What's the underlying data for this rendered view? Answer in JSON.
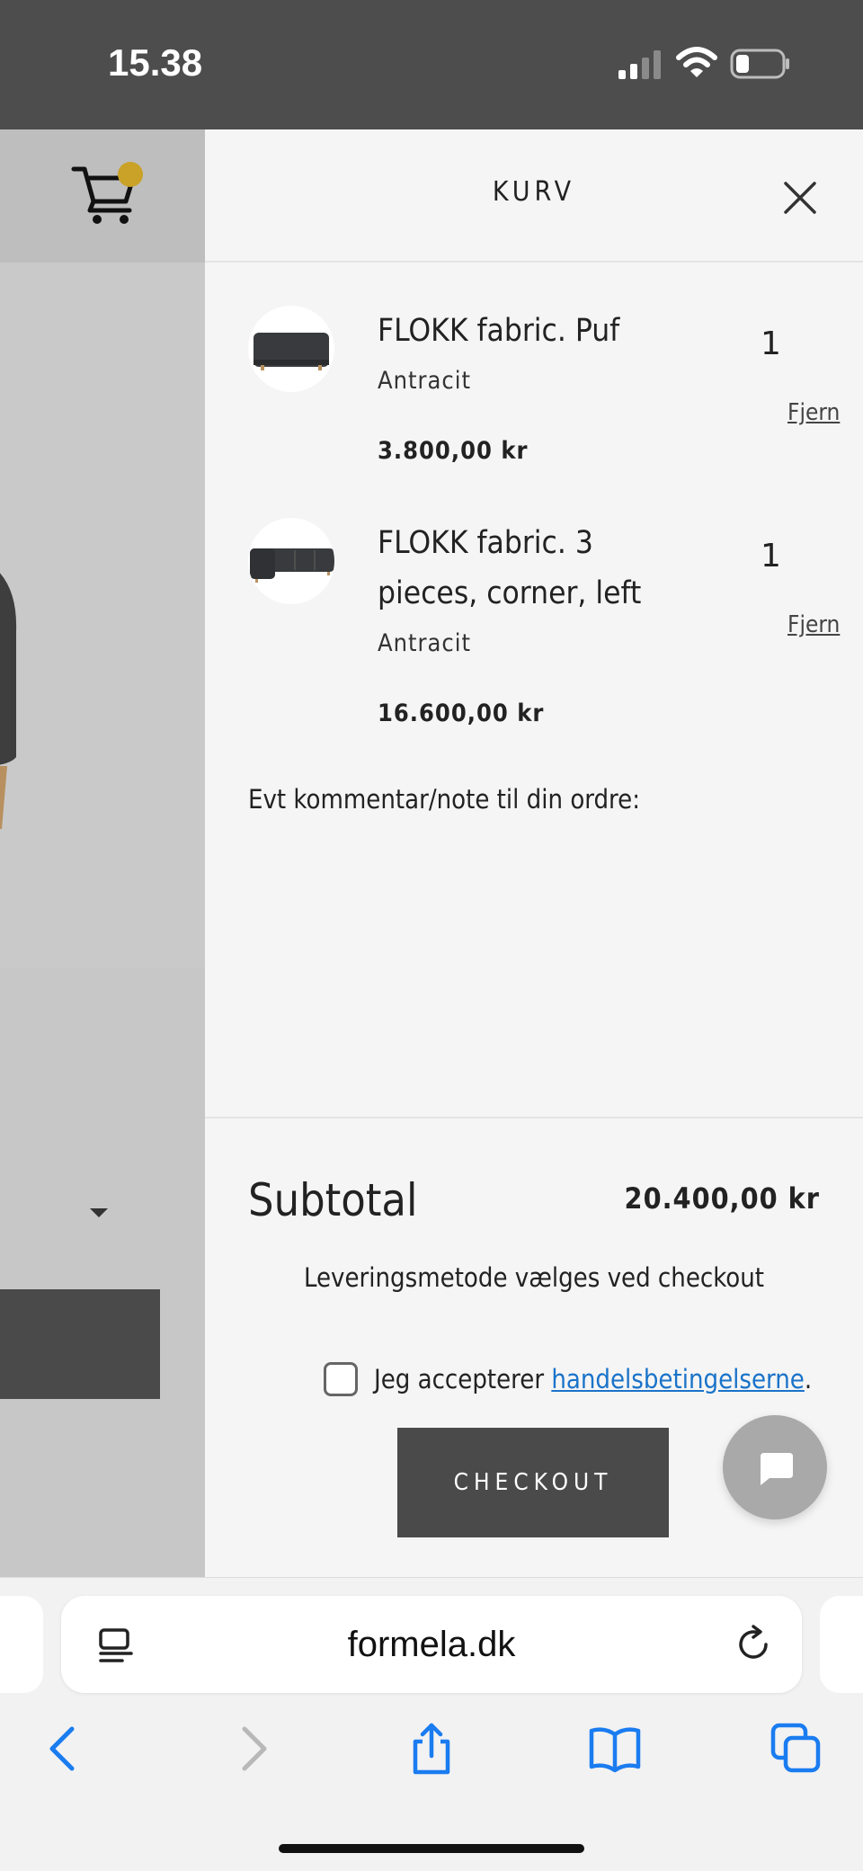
{
  "status_bar": {
    "time": "15.38"
  },
  "drawer": {
    "title": "KURV",
    "items": [
      {
        "name": "FLOKK fabric. Puf",
        "variant": "Antracit",
        "price": "3.800,00 kr",
        "quantity": "1",
        "remove_label": "Fjern"
      },
      {
        "name": "FLOKK fabric. 3 pieces, corner, left",
        "variant": "Antracit",
        "price": "16.600,00 kr",
        "quantity": "1",
        "remove_label": "Fjern"
      }
    ],
    "note_label": "Evt kommentar/note til din ordre:",
    "subtotal_label": "Subtotal",
    "subtotal_value": "20.400,00 kr",
    "delivery_note": "Leveringsmetode vælges ved checkout",
    "terms_prefix": "Jeg accepterer ",
    "terms_link": "handelsbetingelserne",
    "terms_suffix": ".",
    "checkout_label": "CHECKOUT"
  },
  "browser": {
    "url": "formela.dk"
  },
  "colors": {
    "accent_dot": "#c9a227",
    "link": "#1a73c9",
    "ios_blue": "#1a7cf0",
    "button_dark": "#4a4a4a"
  }
}
